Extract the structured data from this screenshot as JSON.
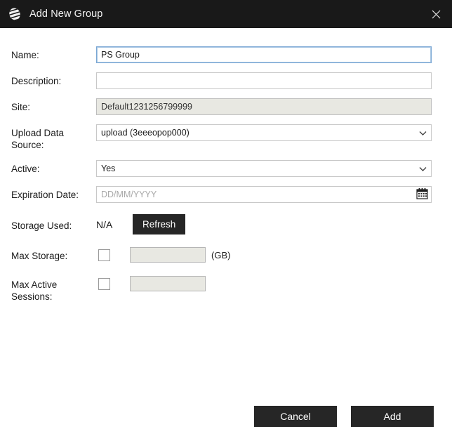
{
  "window": {
    "title": "Add New Group",
    "logo_icon": "app-sphere-logo-icon",
    "close_icon": "close-icon"
  },
  "form": {
    "fields": [
      {
        "label": "Name:",
        "name": "name",
        "value": "PS Group",
        "placeholder": "",
        "type": "text",
        "state": "focused"
      },
      {
        "label": "Description:",
        "name": "description",
        "value": "",
        "placeholder": "",
        "type": "text",
        "state": "normal"
      },
      {
        "label": "Site:",
        "name": "site",
        "value": "Default1231256799999",
        "placeholder": "",
        "type": "text",
        "state": "readonly"
      },
      {
        "label": "Upload Data Source:",
        "name": "upload-data-source",
        "value": "upload (3eeeopop000)",
        "placeholder": "",
        "type": "select",
        "state": "normal"
      },
      {
        "label": "Active:",
        "name": "active",
        "value": "Yes",
        "placeholder": "",
        "type": "select",
        "state": "normal"
      },
      {
        "label": "Expiration Date:",
        "name": "expiration-date",
        "value": "",
        "placeholder": "DD/MM/YYYY",
        "type": "date",
        "state": "normal"
      }
    ],
    "storage_used": {
      "label": "Storage Used:",
      "value": "N/A",
      "refresh_label": "Refresh"
    },
    "max_storage": {
      "label": "Max Storage:",
      "checked": false,
      "value": "",
      "unit": "(GB)"
    },
    "max_active_sessions": {
      "label": "Max Active Sessions:",
      "checked": false,
      "value": ""
    }
  },
  "footer": {
    "cancel_label": "Cancel",
    "add_label": "Add"
  },
  "colors": {
    "titlebar_bg": "#191919",
    "button_bg": "#262626",
    "focus_border": "#7aa7d4",
    "disabled_bg": "#e8e8e2"
  }
}
